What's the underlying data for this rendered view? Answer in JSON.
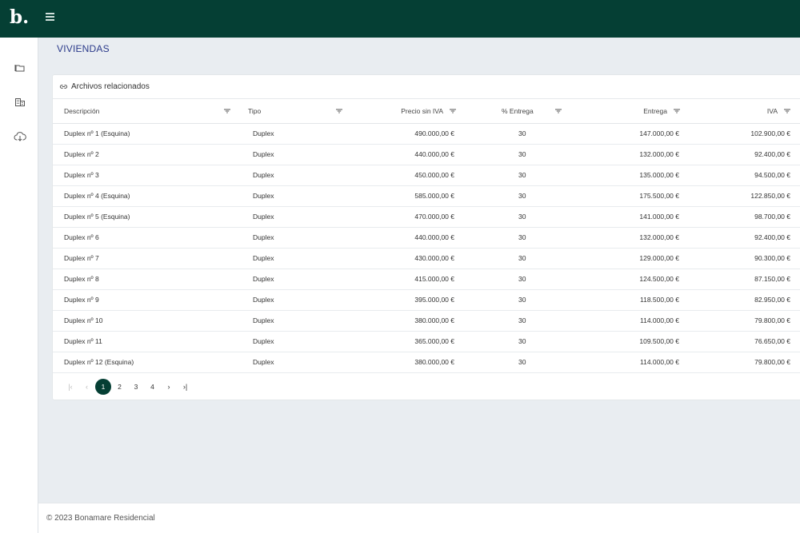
{
  "brand": {
    "logo": "b."
  },
  "page": {
    "title": "VIVIENDAS"
  },
  "sidebar": {
    "items": [
      {
        "icon": "folder-icon"
      },
      {
        "icon": "building-icon"
      },
      {
        "icon": "cloud-download-icon"
      }
    ]
  },
  "card": {
    "title": "Archivos relacionados"
  },
  "table": {
    "headers": {
      "descripcion": "Descripción",
      "tipo": "Tipo",
      "precio": "Precio sin IVA",
      "pct_entrega": "% Entrega",
      "entrega": "Entrega",
      "iva": "IVA"
    },
    "rows": [
      {
        "descripcion": "Duplex nº 1 (Esquina)",
        "tipo": "Duplex",
        "precio": "490.000,00 €",
        "pct_entrega": "30",
        "entrega": "147.000,00 €",
        "iva": "102.900,00 €"
      },
      {
        "descripcion": "Duplex nº 2",
        "tipo": "Duplex",
        "precio": "440.000,00 €",
        "pct_entrega": "30",
        "entrega": "132.000,00 €",
        "iva": "92.400,00 €"
      },
      {
        "descripcion": "Duplex nº 3",
        "tipo": "Duplex",
        "precio": "450.000,00 €",
        "pct_entrega": "30",
        "entrega": "135.000,00 €",
        "iva": "94.500,00 €"
      },
      {
        "descripcion": "Duplex nº 4 (Esquina)",
        "tipo": "Duplex",
        "precio": "585.000,00 €",
        "pct_entrega": "30",
        "entrega": "175.500,00 €",
        "iva": "122.850,00 €"
      },
      {
        "descripcion": "Duplex nº 5 (Esquina)",
        "tipo": "Duplex",
        "precio": "470.000,00 €",
        "pct_entrega": "30",
        "entrega": "141.000,00 €",
        "iva": "98.700,00 €"
      },
      {
        "descripcion": "Duplex nº 6",
        "tipo": "Duplex",
        "precio": "440.000,00 €",
        "pct_entrega": "30",
        "entrega": "132.000,00 €",
        "iva": "92.400,00 €"
      },
      {
        "descripcion": "Duplex nº 7",
        "tipo": "Duplex",
        "precio": "430.000,00 €",
        "pct_entrega": "30",
        "entrega": "129.000,00 €",
        "iva": "90.300,00 €"
      },
      {
        "descripcion": "Duplex nº 8",
        "tipo": "Duplex",
        "precio": "415.000,00 €",
        "pct_entrega": "30",
        "entrega": "124.500,00 €",
        "iva": "87.150,00 €"
      },
      {
        "descripcion": "Duplex nº 9",
        "tipo": "Duplex",
        "precio": "395.000,00 €",
        "pct_entrega": "30",
        "entrega": "118.500,00 €",
        "iva": "82.950,00 €"
      },
      {
        "descripcion": "Duplex nº 10",
        "tipo": "Duplex",
        "precio": "380.000,00 €",
        "pct_entrega": "30",
        "entrega": "114.000,00 €",
        "iva": "79.800,00 €"
      },
      {
        "descripcion": "Duplex nº 11",
        "tipo": "Duplex",
        "precio": "365.000,00 €",
        "pct_entrega": "30",
        "entrega": "109.500,00 €",
        "iva": "76.650,00 €"
      },
      {
        "descripcion": "Duplex nº 12 (Esquina)",
        "tipo": "Duplex",
        "precio": "380.000,00 €",
        "pct_entrega": "30",
        "entrega": "114.000,00 €",
        "iva": "79.800,00 €"
      }
    ]
  },
  "pagination": {
    "first": "|‹",
    "prev": "‹",
    "pages": [
      "1",
      "2",
      "3",
      "4"
    ],
    "current": "1",
    "next": "›",
    "last": "›|"
  },
  "footer": {
    "text": "© 2023 Bonamare Residencial"
  },
  "colors": {
    "brand_dark": "#053f34",
    "title_blue": "#2b3a8a",
    "background": "#e9edf1"
  }
}
